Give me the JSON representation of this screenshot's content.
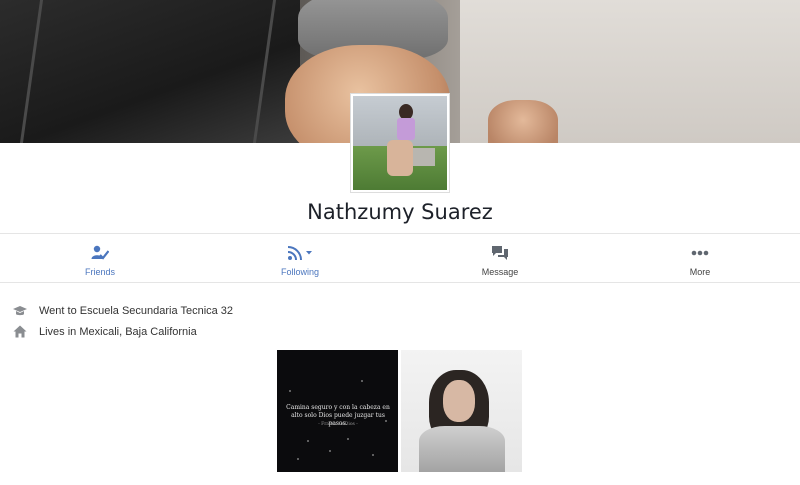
{
  "profile": {
    "name": "Nathzumy Suarez"
  },
  "actions": [
    {
      "label": "Friends",
      "icon": "friends-check-icon"
    },
    {
      "label": "Following",
      "icon": "rss-dropdown-icon"
    },
    {
      "label": "Message",
      "icon": "chat-bubbles-icon"
    },
    {
      "label": "More",
      "icon": "ellipsis-icon"
    }
  ],
  "info": [
    {
      "text": "Went to Escuela Secundaria Tecnica 32",
      "icon": "graduation-cap-icon"
    },
    {
      "text": "Lives in Mexicali, Baja California",
      "icon": "home-icon"
    }
  ],
  "photos": {
    "first_caption": "Camina seguro y con la cabeza en alto solo Dios puede juzgar tus pasos.",
    "first_author": "- Frases de Dios -"
  },
  "colors": {
    "accent": "#4b76be",
    "icon_gray": "#606770"
  }
}
